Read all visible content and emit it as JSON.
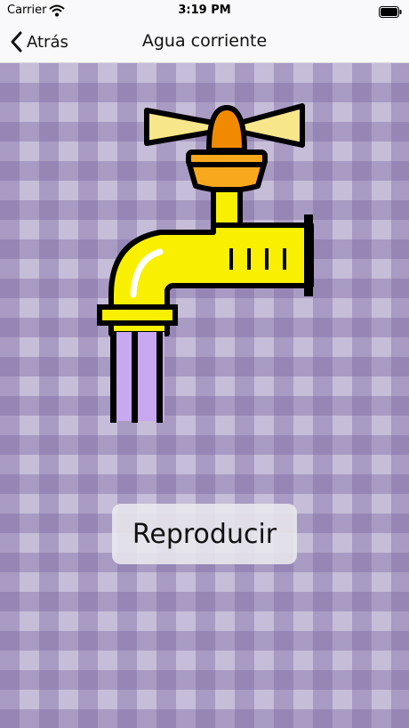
{
  "status_bar": {
    "carrier": "Carrier",
    "time": "3:19 PM"
  },
  "nav": {
    "back_label": "Atrás",
    "title": "Agua corriente"
  },
  "main": {
    "play_button": "Reproducir",
    "image_icon": "faucet-icon"
  }
}
